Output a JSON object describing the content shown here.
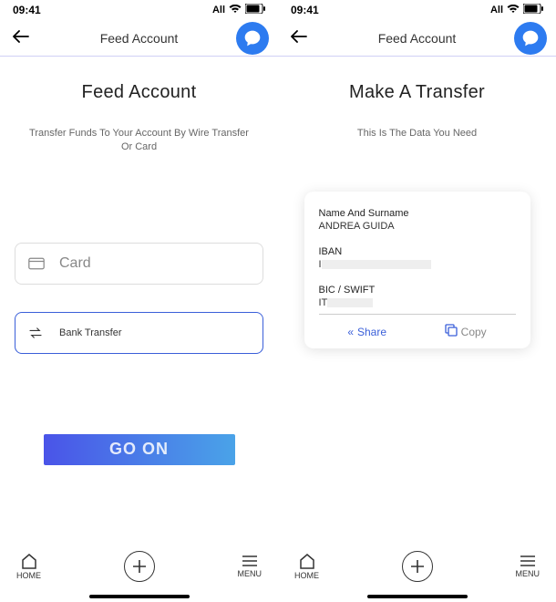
{
  "status": {
    "time": "09:41",
    "carrier": "All"
  },
  "left": {
    "nav_title": "Feed Account",
    "page_title": "Feed Account",
    "subtitle": "Transfer Funds To Your Account By Wire Transfer Or Card",
    "option_card": "Card",
    "option_bank": "Bank Transfer",
    "go_button": "GO ON"
  },
  "right": {
    "nav_title": "Feed Account",
    "page_title": "Make A Transfer",
    "subtitle": "This Is The Data You Need",
    "card": {
      "name_label": "Name And Surname",
      "name_value": "ANDREA GUIDA",
      "iban_label": "IBAN",
      "iban_value": "I",
      "bic_label": "BIC / SWIFT",
      "bic_value": "IT",
      "share": "Share",
      "copy": "Copy"
    }
  },
  "bottom": {
    "home": "HOME",
    "menu": "MENU"
  }
}
